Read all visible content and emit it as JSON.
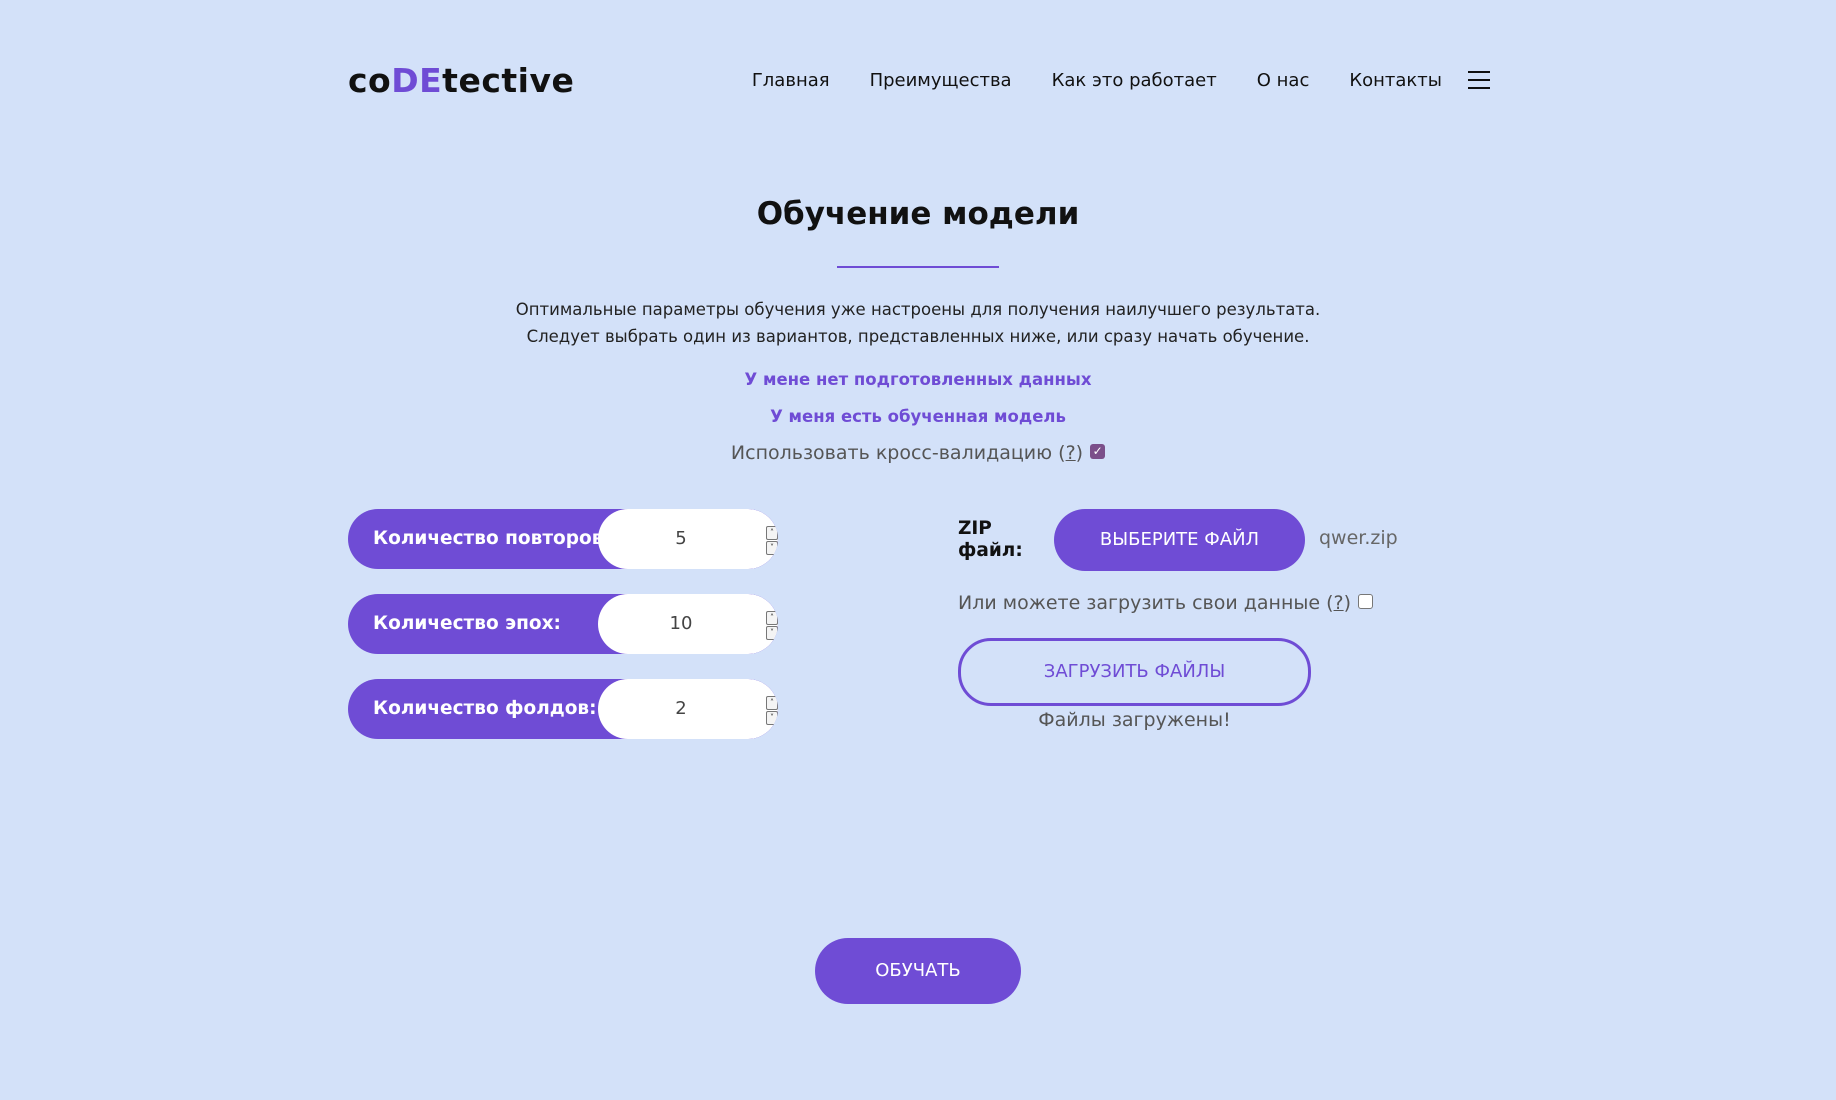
{
  "header": {
    "logo_prefix": "co",
    "logo_accent": "DE",
    "logo_suffix": "tective",
    "nav": [
      "Главная",
      "Преимущества",
      "Как это работает",
      "О нас",
      "Контакты"
    ]
  },
  "main": {
    "title": "Обучение модели",
    "description_line1": "Оптимальные параметры обучения уже настроены для получения наилучшего результата.",
    "description_line2": "Следует выбрать один из вариантов, представленных ниже, или сразу начать обучение.",
    "link_no_data": "У мене нет подготовленных данных",
    "link_have_model": "У меня есть обученная модель",
    "cross_validation_label": "Использовать кросс-валидацию (",
    "help_mark": "?",
    "close_paren": ")",
    "cross_validation_checked": true
  },
  "params": [
    {
      "label": "Количество повторов",
      "value": "5"
    },
    {
      "label": "Количество эпох:",
      "value": "10"
    },
    {
      "label": "Количество фолдов:",
      "value": "2"
    }
  ],
  "upload": {
    "zip_label": "ZIP файл:",
    "choose_button": "ВЫБЕРИТЕ ФАЙЛ",
    "file_name": "qwer.zip",
    "own_data_label": "Или можете загрузить свои данные (",
    "own_data_checked": false,
    "upload_button": "ЗАГРУЗИТЬ ФАЙЛЫ",
    "status": "Файлы загружены!"
  },
  "train_button": "ОБУЧАТЬ",
  "colors": {
    "background": "#d3e1f9",
    "accent": "#6f4cd5"
  }
}
